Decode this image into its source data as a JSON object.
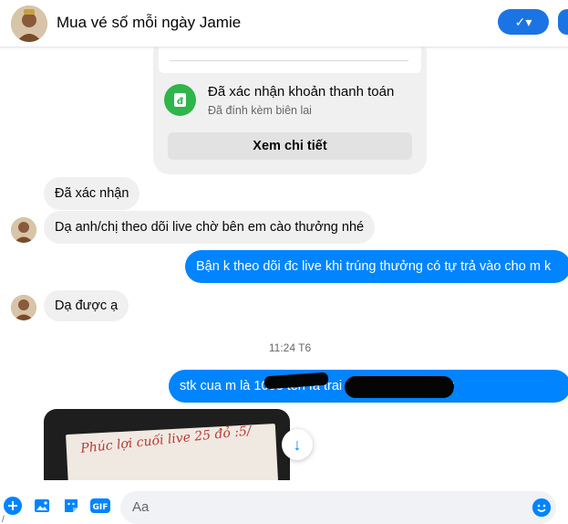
{
  "header": {
    "title": "Mua vé số mỗi ngày Jamie",
    "action_label": "✓▾",
    "colors": {
      "accent": "#1b74e4"
    }
  },
  "receipt_card": {
    "title": "Đã xác nhận khoản thanh toán",
    "subtitle": "Đã đính kèm biên lai",
    "button_label": "Xem chi tiết",
    "icon": "receipt-icon"
  },
  "messages": [
    {
      "from": "them",
      "text": "Đã xác nhận"
    },
    {
      "from": "them",
      "text": "Dạ anh/chị theo dõi live chờ bên em cào thưởng nhé"
    },
    {
      "from": "me",
      "text": "Bận k theo dõi đc live khi trúng thưởng có tự trả vào cho m k"
    },
    {
      "from": "them",
      "text": "Dạ được ạ"
    },
    {
      "from": "me",
      "text": "stk cua m là 1003            tên     fa trai                 ngan hang vpbank"
    }
  ],
  "timestamp": "11:24 T6",
  "photo_text": "Phúc lợi cuối live  25 đỏ :5/",
  "composer": {
    "placeholder": "Aa",
    "icons": [
      "plus-icon",
      "image-icon",
      "sticker-icon",
      "gif-icon",
      "emoji-icon"
    ],
    "gif_label": "GIF"
  },
  "colors": {
    "outgoing": "#0084ff",
    "incoming": "#f0f0f0"
  },
  "misc": {
    "edge_char": "/"
  }
}
